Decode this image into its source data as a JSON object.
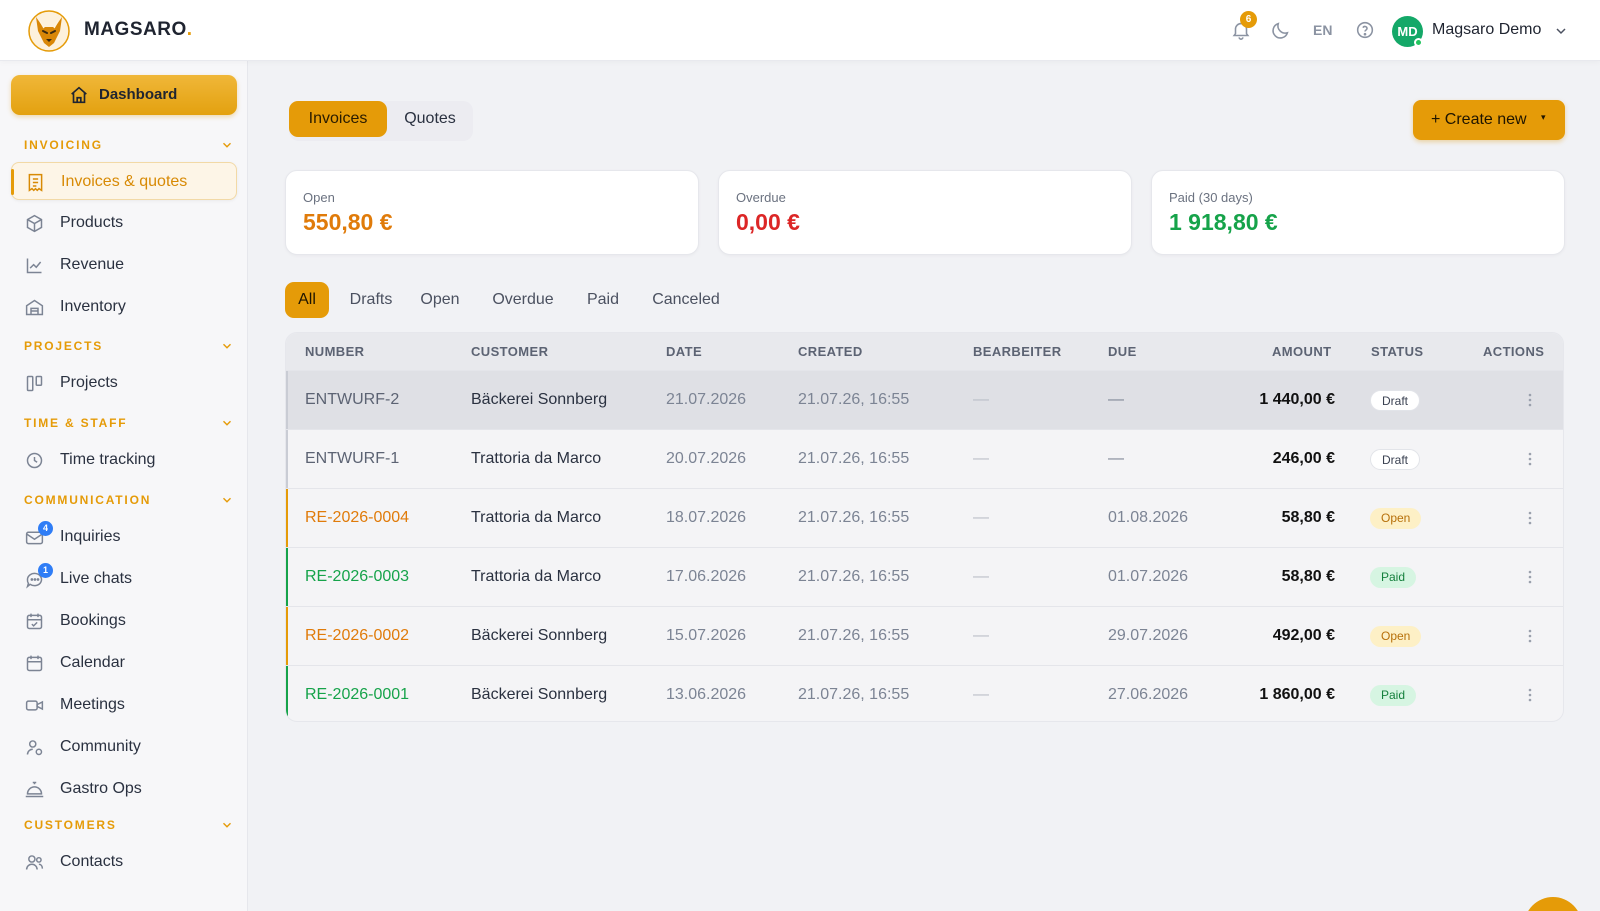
{
  "brand": {
    "name": "MAGSARO",
    "dot": "."
  },
  "topbar": {
    "notifications_count": "6",
    "language": "EN",
    "user": {
      "initials": "MD",
      "name": "Magsaro Demo"
    },
    "icons": [
      "bell-icon",
      "moon-icon",
      "help-icon",
      "chevron-down-icon"
    ]
  },
  "sidebar": {
    "dashboard_label": "Dashboard",
    "sections": [
      {
        "title": "INVOICING",
        "items": [
          {
            "label": "Invoices & quotes",
            "icon": "invoice-icon",
            "active": true
          },
          {
            "label": "Products",
            "icon": "box-icon"
          },
          {
            "label": "Revenue",
            "icon": "chart-line-icon"
          },
          {
            "label": "Inventory",
            "icon": "warehouse-icon"
          }
        ]
      },
      {
        "title": "PROJECTS",
        "items": [
          {
            "label": "Projects",
            "icon": "kanban-icon"
          }
        ]
      },
      {
        "title": "TIME & STAFF",
        "items": [
          {
            "label": "Time tracking",
            "icon": "clock-icon"
          }
        ]
      },
      {
        "title": "COMMUNICATION",
        "items": [
          {
            "label": "Inquiries",
            "icon": "mail-icon",
            "badge": "4"
          },
          {
            "label": "Live chats",
            "icon": "chat-icon",
            "badge": "1"
          },
          {
            "label": "Bookings",
            "icon": "calendar-check-icon"
          },
          {
            "label": "Calendar",
            "icon": "calendar-icon"
          },
          {
            "label": "Meetings",
            "icon": "video-icon"
          },
          {
            "label": "Community",
            "icon": "community-icon"
          },
          {
            "label": "Gastro Ops",
            "icon": "cloche-icon"
          }
        ]
      },
      {
        "title": "CUSTOMERS",
        "items": [
          {
            "label": "Contacts",
            "icon": "users-icon"
          }
        ]
      }
    ]
  },
  "main": {
    "tabs": [
      {
        "label": "Invoices",
        "active": true
      },
      {
        "label": "Quotes"
      }
    ],
    "create_label": "+ Create new",
    "create_caret": "▾",
    "summary": [
      {
        "label": "Open",
        "value": "550,80 €",
        "color": "#e07b0a"
      },
      {
        "label": "Overdue",
        "value": "0,00 €",
        "color": "#dc2626"
      },
      {
        "label": "Paid (30 days)",
        "value": "1 918,80 €",
        "color": "#16a34a"
      }
    ],
    "filters": [
      {
        "label": "All",
        "active": true
      },
      {
        "label": "Drafts"
      },
      {
        "label": "Open"
      },
      {
        "label": "Overdue"
      },
      {
        "label": "Paid"
      },
      {
        "label": "Canceled"
      }
    ],
    "table": {
      "headers": [
        "NUMBER",
        "CUSTOMER",
        "DATE",
        "CREATED",
        "BEARBEITER",
        "DUE",
        "AMOUNT",
        "STATUS",
        "ACTIONS"
      ],
      "rows": [
        {
          "number": "ENTWURF-2",
          "customer": "Bäckerei Sonnberg",
          "date": "21.07.2026",
          "created": "21.07.26, 16:55",
          "bearbeiter": "—",
          "due": "—",
          "amount": "1 440,00 €",
          "status": "Draft",
          "kind": "draft"
        },
        {
          "number": "ENTWURF-1",
          "customer": "Trattoria da Marco",
          "date": "20.07.2026",
          "created": "21.07.26, 16:55",
          "bearbeiter": "—",
          "due": "—",
          "amount": "246,00 €",
          "status": "Draft",
          "kind": "draft"
        },
        {
          "number": "RE-2026-0004",
          "customer": "Trattoria da Marco",
          "date": "18.07.2026",
          "created": "21.07.26, 16:55",
          "bearbeiter": "—",
          "due": "01.08.2026",
          "amount": "58,80 €",
          "status": "Open",
          "kind": "open"
        },
        {
          "number": "RE-2026-0003",
          "customer": "Trattoria da Marco",
          "date": "17.06.2026",
          "created": "21.07.26, 16:55",
          "bearbeiter": "—",
          "due": "01.07.2026",
          "amount": "58,80 €",
          "status": "Paid",
          "kind": "paid"
        },
        {
          "number": "RE-2026-0002",
          "customer": "Bäckerei Sonnberg",
          "date": "15.07.2026",
          "created": "21.07.26, 16:55",
          "bearbeiter": "—",
          "due": "29.07.2026",
          "amount": "492,00 €",
          "status": "Open",
          "kind": "open"
        },
        {
          "number": "RE-2026-0001",
          "customer": "Bäckerei Sonnberg",
          "date": "13.06.2026",
          "created": "21.07.26, 16:55",
          "bearbeiter": "—",
          "due": "27.06.2026",
          "amount": "1 860,00 €",
          "status": "Paid",
          "kind": "paid"
        }
      ]
    }
  },
  "colors": {
    "accent": "#e59b08",
    "open": "#e07b0a",
    "overdue": "#dc2626",
    "paid": "#16a34a",
    "draft": "#5c6373"
  }
}
